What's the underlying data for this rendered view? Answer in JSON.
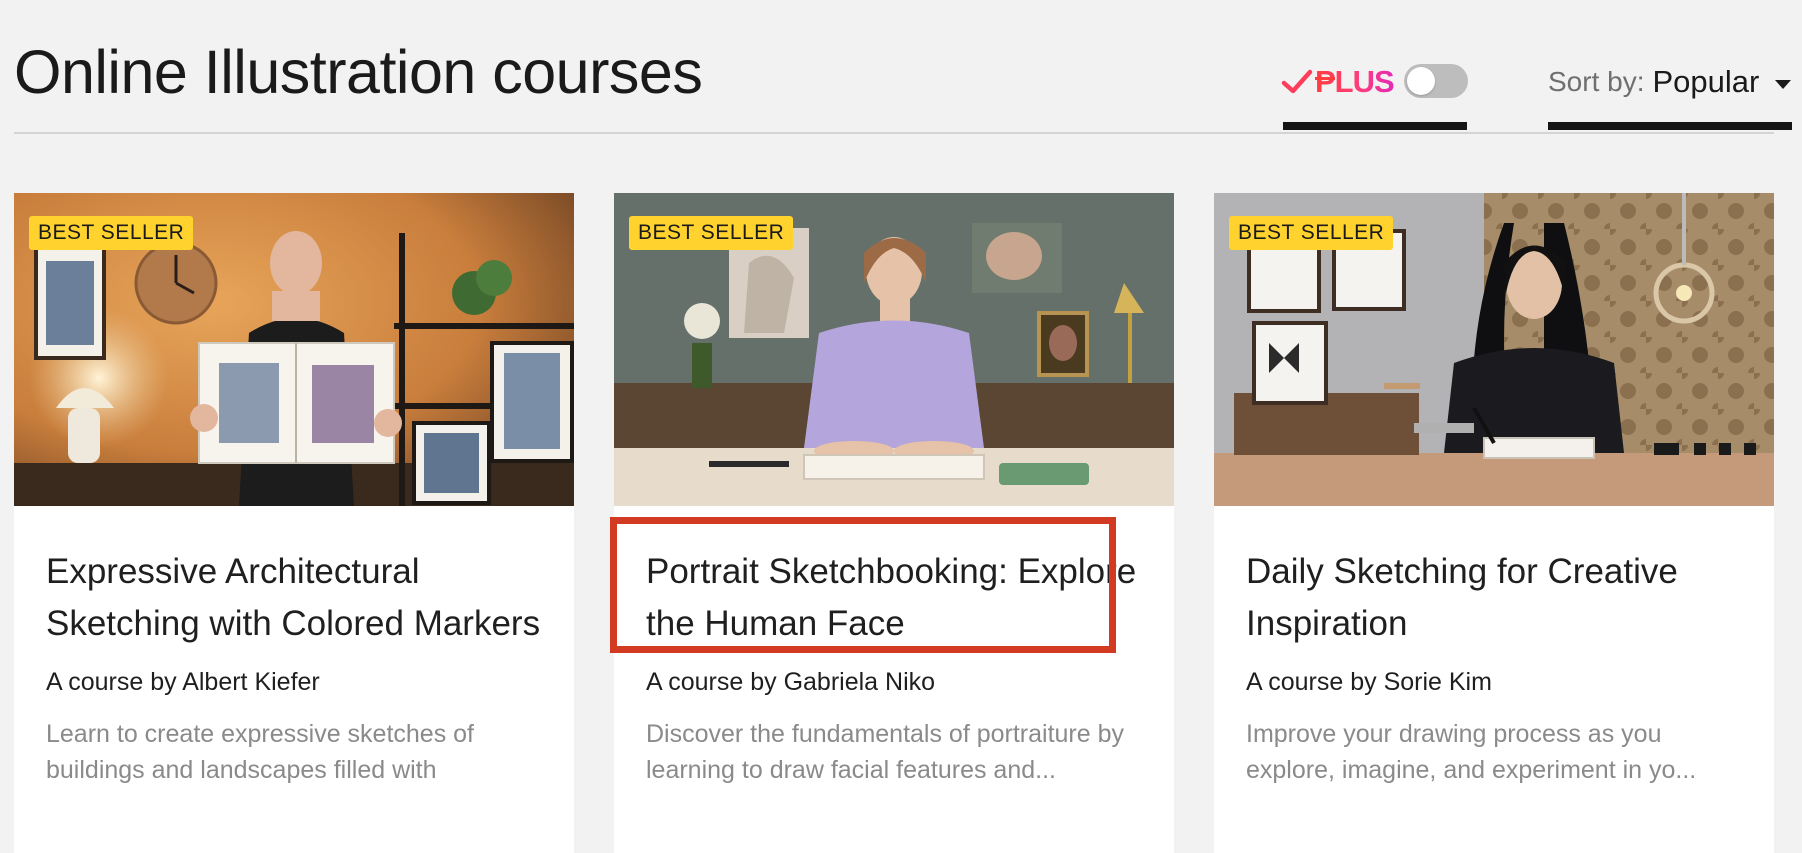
{
  "header": {
    "title": "Online Illustration courses",
    "plus": {
      "label": "PLUS",
      "toggle_on": false,
      "brand_color_start": "#ff3d3d",
      "brand_color_end": "#e22cb5"
    },
    "sort": {
      "label": "Sort by:",
      "value": "Popular"
    }
  },
  "courses": [
    {
      "badge": "BEST SELLER",
      "title": "Expressive Architectural Sketching with Colored Markers",
      "author": "A course by Albert Kiefer",
      "description": "Learn to create expressive sketches of buildings and landscapes filled with"
    },
    {
      "badge": "BEST SELLER",
      "title": "Portrait Sketchbooking: Explore the Human Face",
      "author": "A course by Gabriela Niko",
      "description": "Discover the fundamentals of portraiture by learning to draw facial features and...",
      "highlighted": true
    },
    {
      "badge": "BEST SELLER",
      "title": "Daily Sketching for Creative Inspiration",
      "author": "A course by Sorie Kim",
      "description": "Improve your drawing process as you explore, imagine, and experiment in yo..."
    }
  ],
  "colors": {
    "background": "#f2f2f2",
    "badge": "#ffd22e",
    "highlight": "#d23a22",
    "muted_text": "#8a8a8a"
  }
}
